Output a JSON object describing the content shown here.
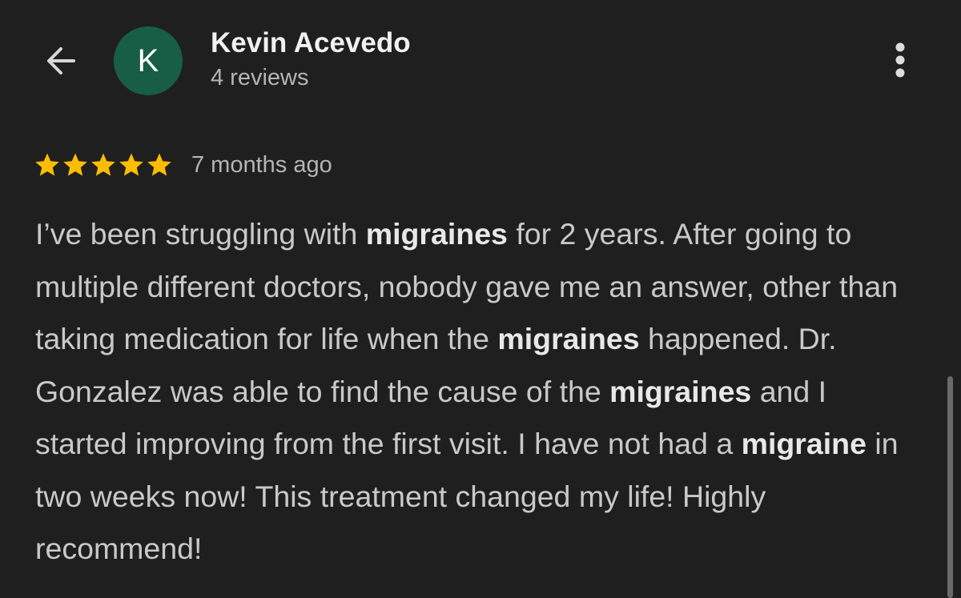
{
  "header": {
    "back_icon": "arrow-left-icon",
    "avatar_letter": "K",
    "avatar_color": "#185d46",
    "reviewer_name": "Kevin Acevedo",
    "review_count": "4 reviews",
    "more_icon": "more-vertical-icon"
  },
  "review": {
    "rating": 5,
    "max_rating": 5,
    "star_color": "#fbbc04",
    "time_ago": "7 months ago",
    "segments": [
      {
        "text": "I’ve been struggling with ",
        "bold": false
      },
      {
        "text": "migraines",
        "bold": true
      },
      {
        "text": " for 2 years. After going to multiple different doctors, nobody gave me an answer, other than taking medication for life when the ",
        "bold": false
      },
      {
        "text": "migraines",
        "bold": true
      },
      {
        "text": " happened. Dr. Gonzalez was able to find the cause of the ",
        "bold": false
      },
      {
        "text": "migraines",
        "bold": true
      },
      {
        "text": " and I started improving from the first visit. I have not had a ",
        "bold": false
      },
      {
        "text": "migraine",
        "bold": true
      },
      {
        "text": " in two weeks now! This treatment changed my life! Highly recommend!",
        "bold": false
      }
    ]
  },
  "colors": {
    "background": "#1f1f1f",
    "primary_text": "#f1f1f1",
    "secondary_text": "#b5b5b5",
    "body_text": "#c9c9c9"
  }
}
